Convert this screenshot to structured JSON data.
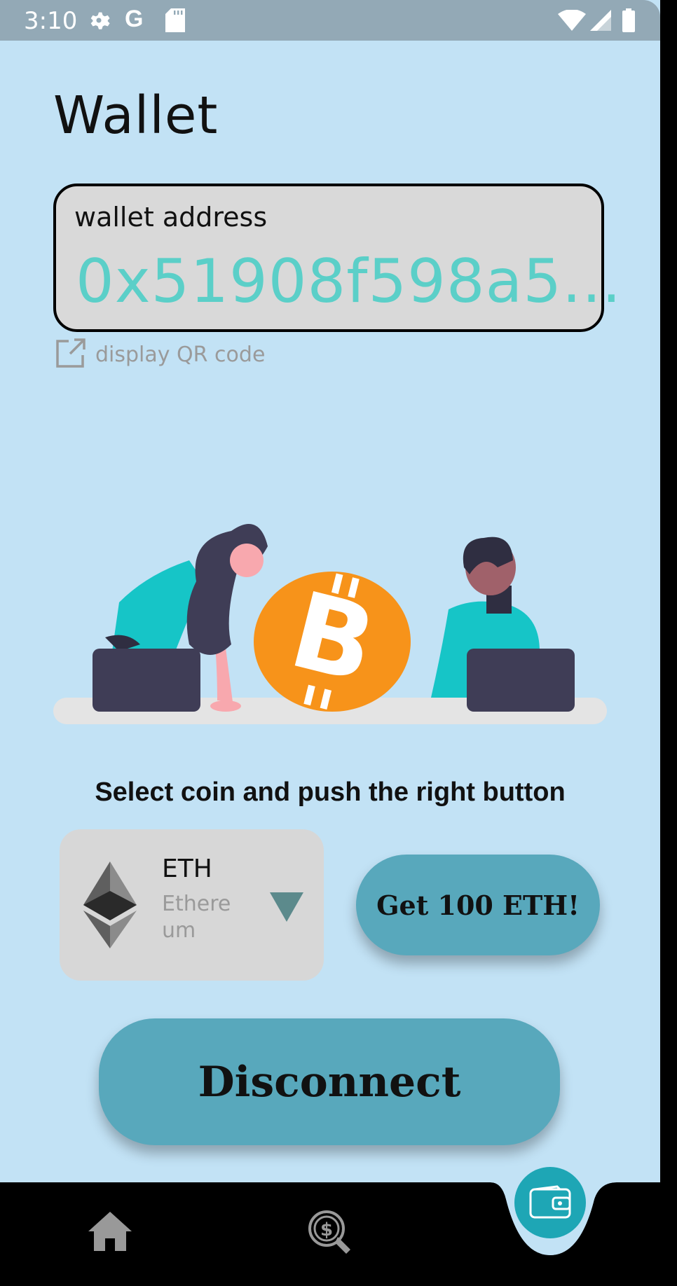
{
  "status_bar": {
    "time": "3:10",
    "icons": [
      "settings-icon",
      "google-icon",
      "sd-card-icon",
      "wifi-icon",
      "signal-icon",
      "battery-icon"
    ]
  },
  "page": {
    "title": "Wallet"
  },
  "wallet": {
    "label": "wallet address",
    "address": "0x51908f598a5..."
  },
  "qr": {
    "label": "display QR code",
    "icon": "external-link-icon"
  },
  "illustration": {
    "icon": "bitcoin-illustration"
  },
  "instruction": "Select coin and push the right button",
  "coin": {
    "symbol": "ETH",
    "name": "Ethereum",
    "icon": "ethereum-icon"
  },
  "actions": {
    "get_label": "Get 100 ETH!",
    "disconnect_label": "Disconnect"
  },
  "nav": {
    "items": [
      "home-icon",
      "coin-search-icon",
      "wallet-icon"
    ],
    "active": "wallet-icon"
  },
  "colors": {
    "background": "#c2e2f5",
    "accent": "#58a8bc",
    "address": "#5bcfc8",
    "bitcoin": "#f7931a",
    "nav_active": "#1ea6b5"
  }
}
